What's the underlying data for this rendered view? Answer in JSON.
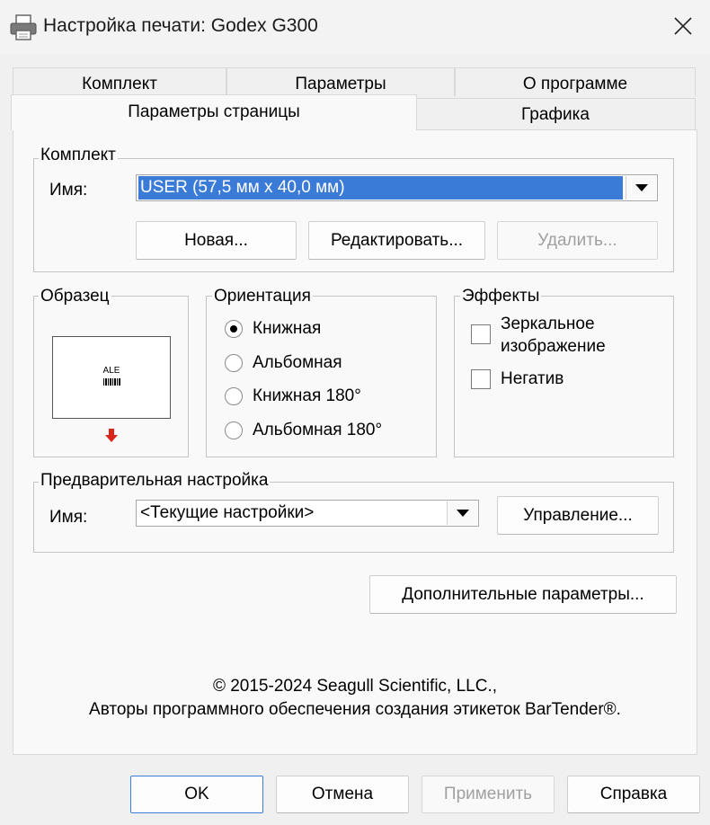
{
  "window": {
    "title": "Настройка печати: Godex G300",
    "icon": "printer-icon",
    "close_icon": "close-icon"
  },
  "tabs": {
    "row_back": [
      "Комплект",
      "Параметры",
      "О программе"
    ],
    "row_front": [
      "Параметры страницы",
      "Графика"
    ],
    "active": "Параметры страницы"
  },
  "kit": {
    "legend": "Комплект",
    "name_label": "Имя:",
    "name_value": "USER (57,5 мм x 40,0 мм)",
    "buttons": {
      "new": "Новая...",
      "edit": "Редактировать...",
      "delete": "Удалить..."
    }
  },
  "sample": {
    "legend": "Образец",
    "preview_text": "ALE",
    "arrow_color": "#d9261c"
  },
  "orientation": {
    "legend": "Ориентация",
    "options": [
      "Книжная",
      "Альбомная",
      "Книжная 180°",
      "Альбомная 180°"
    ],
    "selected": "Книжная"
  },
  "effects": {
    "legend": "Эффекты",
    "mirror": "Зеркальное",
    "mirror_line2": "изображение",
    "mirror_checked": false,
    "negative": "Негатив",
    "negative_checked": false
  },
  "preset": {
    "legend": "Предварительная настройка",
    "name_label": "Имя:",
    "name_value": "<Текущие настройки>",
    "manage": "Управление..."
  },
  "advanced_button": "Дополнительные параметры...",
  "copyright": {
    "line1": "© 2015-2024 Seagull Scientific, LLC.,",
    "line2": "Авторы программного обеспечения создания этикеток BarTender®."
  },
  "footer": {
    "ok": "OK",
    "cancel": "Отмена",
    "apply": "Применить",
    "help": "Справка"
  },
  "colors": {
    "accent": "#3b7bd8",
    "disabled_text": "#a0a0a0"
  }
}
